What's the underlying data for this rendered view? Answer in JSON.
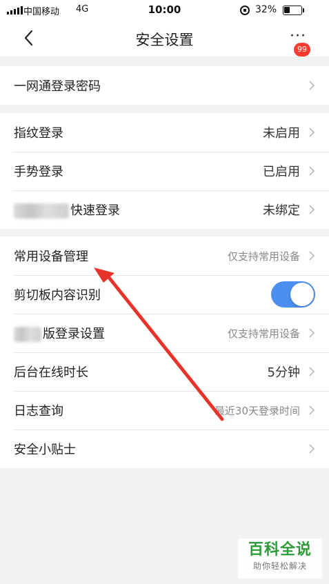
{
  "status_bar": {
    "carrier": "中国移动",
    "network": "4G",
    "time": "10:00",
    "battery": "32%",
    "battery_level": 0.32
  },
  "nav": {
    "title": "安全设置",
    "more": "···",
    "badge": "99"
  },
  "groups": {
    "account": {
      "password": {
        "label": "一网通登录密码"
      }
    },
    "login": {
      "fingerprint": {
        "label": "指纹登录",
        "value": "未启用"
      },
      "gesture": {
        "label": "手势登录",
        "value": "已启用"
      },
      "quick": {
        "label": "快速登录",
        "value": "未绑定"
      }
    },
    "device": {
      "common_device": {
        "label": "常用设备管理",
        "value": "仅支持常用设备"
      },
      "clipboard": {
        "label": "剪切板内容识别",
        "enabled": true
      },
      "pad_login": {
        "label": "版登录设置",
        "value": "仅支持常用设备"
      },
      "online_time": {
        "label": "后台在线时长",
        "value": "5分钟"
      },
      "log_query": {
        "label": "日志查询",
        "value": "最近30天登录时间"
      },
      "tips": {
        "label": "安全小贴士"
      }
    }
  },
  "watermark": {
    "title": "百科全说",
    "subtitle": "助你轻松解决"
  },
  "colors": {
    "accent": "#4a8ef0",
    "badge": "#ff3b30",
    "annotation_arrow": "#e8332a",
    "watermark_green": "#2e9b3a"
  }
}
